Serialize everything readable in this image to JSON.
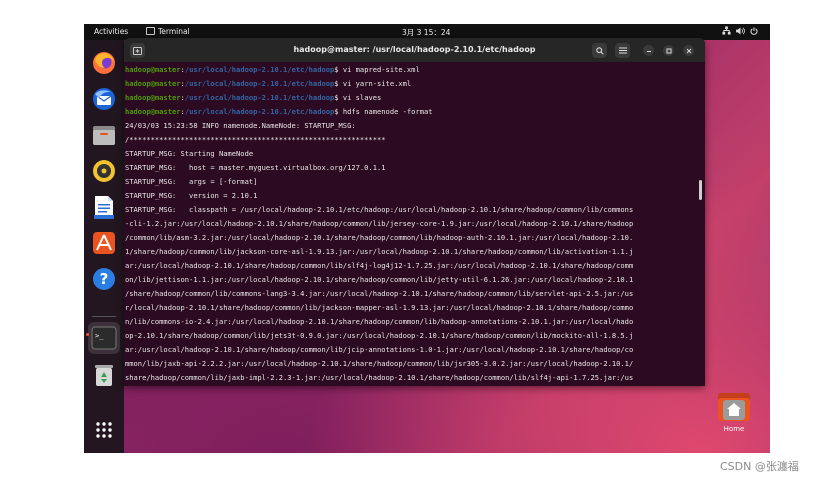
{
  "topbar": {
    "activities": "Activities",
    "app": "Terminal",
    "clock": "3月 3  15：24"
  },
  "dock": {
    "apps": [
      {
        "name": "Firefox",
        "icon": "firefox-icon"
      },
      {
        "name": "Thunderbird",
        "icon": "thunderbird-icon"
      },
      {
        "name": "Files",
        "icon": "files-icon"
      },
      {
        "name": "Rhythmbox",
        "icon": "rhythmbox-icon"
      },
      {
        "name": "LibreOffice Writer",
        "icon": "writer-icon"
      },
      {
        "name": "App Center",
        "icon": "app-center-icon"
      },
      {
        "name": "Help",
        "icon": "help-icon"
      },
      {
        "name": "Terminal",
        "icon": "terminal-icon"
      },
      {
        "name": "Trash",
        "icon": "trash-icon"
      },
      {
        "name": "Show Apps",
        "icon": "grid-icon"
      }
    ],
    "help_glyph": "?",
    "terminal_glyph": ">_"
  },
  "terminal": {
    "title": "hadoop@master: /usr/local/hadoop-2.10.1/etc/hadoop",
    "prompt_user": "hadoop@master",
    "prompt_path": "/usr/local/hadoop-2.10.1/etc/hadoop",
    "prompts": [
      {
        "cmd": " vi mapred-site.xml"
      },
      {
        "cmd": " vi yarn-site.xml"
      },
      {
        "cmd": " vi slaves"
      },
      {
        "cmd": " hdfs namenode -format"
      }
    ],
    "output": [
      "24/03/03 15:23:58 INFO namenode.NameNode: STARTUP_MSG:",
      "/************************************************************",
      "STARTUP_MSG: Starting NameNode",
      "STARTUP_MSG:   host = master.myguest.virtualbox.org/127.0.1.1",
      "STARTUP_MSG:   args = [-format]",
      "STARTUP_MSG:   version = 2.10.1",
      "STARTUP_MSG:   classpath = /usr/local/hadoop-2.10.1/etc/hadoop:/usr/local/hadoop-2.10.1/share/hadoop/common/lib/commons",
      "-cli-1.2.jar:/usr/local/hadoop-2.10.1/share/hadoop/common/lib/jersey-core-1.9.jar:/usr/local/hadoop-2.10.1/share/hadoop",
      "/common/lib/asm-3.2.jar:/usr/local/hadoop-2.10.1/share/hadoop/common/lib/hadoop-auth-2.10.1.jar:/usr/local/hadoop-2.10.",
      "1/share/hadoop/common/lib/jackson-core-asl-1.9.13.jar:/usr/local/hadoop-2.10.1/share/hadoop/common/lib/activation-1.1.j",
      "ar:/usr/local/hadoop-2.10.1/share/hadoop/common/lib/slf4j-log4j12-1.7.25.jar:/usr/local/hadoop-2.10.1/share/hadoop/comm",
      "on/lib/jettison-1.1.jar:/usr/local/hadoop-2.10.1/share/hadoop/common/lib/jetty-util-6.1.26.jar:/usr/local/hadoop-2.10.1",
      "/share/hadoop/common/lib/commons-lang3-3.4.jar:/usr/local/hadoop-2.10.1/share/hadoop/common/lib/servlet-api-2.5.jar:/us",
      "r/local/hadoop-2.10.1/share/hadoop/common/lib/jackson-mapper-asl-1.9.13.jar:/usr/local/hadoop-2.10.1/share/hadoop/commo",
      "n/lib/commons-io-2.4.jar:/usr/local/hadoop-2.10.1/share/hadoop/common/lib/hadoop-annotations-2.10.1.jar:/usr/local/hado",
      "op-2.10.1/share/hadoop/common/lib/jets3t-0.9.0.jar:/usr/local/hadoop-2.10.1/share/hadoop/common/lib/mockito-all-1.8.5.j",
      "ar:/usr/local/hadoop-2.10.1/share/hadoop/common/lib/jcip-annotations-1.0-1.jar:/usr/local/hadoop-2.10.1/share/hadoop/co",
      "mmon/lib/jaxb-api-2.2.2.jar:/usr/local/hadoop-2.10.1/share/hadoop/common/lib/jsr305-3.0.2.jar:/usr/local/hadoop-2.10.1/",
      "share/hadoop/common/lib/jaxb-impl-2.2.3-1.jar:/usr/local/hadoop-2.10.1/share/hadoop/common/lib/slf4j-api-1.7.25.jar:/us"
    ]
  },
  "desktop": {
    "home_label": "Home"
  },
  "watermark": "CSDN @张瀍福",
  "colors": {
    "prompt_user": "#4e9a06",
    "prompt_path": "#3465a4",
    "terminal_bg": "#2c0a22",
    "accent": "#e95420"
  }
}
